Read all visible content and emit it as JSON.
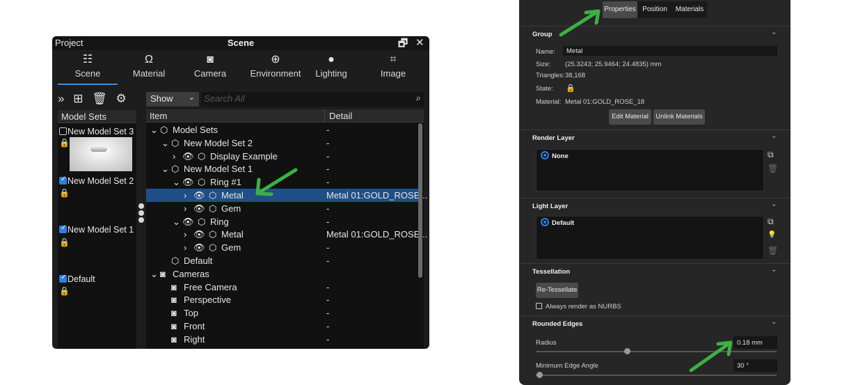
{
  "scene_window": {
    "title_left": "Project",
    "title_center": "Scene",
    "restore_glyph": "🗗",
    "close_glyph": "✕",
    "tabs": [
      {
        "label": "Scene",
        "icon": "☷"
      },
      {
        "label": "Material",
        "icon": "Ω"
      },
      {
        "label": "Camera",
        "icon": "◙"
      },
      {
        "label": "Environment",
        "icon": "⊕"
      },
      {
        "label": "Lighting",
        "icon": "●"
      },
      {
        "label": "Image",
        "icon": "⌗"
      }
    ],
    "toolbar": {
      "expand": "»",
      "add": "⊞",
      "delete": "🗑",
      "settings": "⚙"
    },
    "filter": {
      "value": "Show",
      "chevron": "⌄",
      "search_placeholder": "Search All",
      "search_icon": "⌕"
    },
    "model_sets": {
      "header": "Model Sets",
      "lock_glyph": "🔒",
      "items": [
        {
          "label": "New Model Set 3",
          "checked": false
        },
        {
          "label": "New Model Set 2",
          "checked": true
        },
        {
          "label": "New Model Set 1",
          "checked": true
        },
        {
          "label": "Default",
          "checked": true
        }
      ]
    },
    "tree": {
      "col_item": "Item",
      "col_detail": "Detail",
      "rows": [
        {
          "arrow": "⌄",
          "eye": "",
          "icon": "⬡",
          "label": "Model Sets",
          "detail": "-"
        },
        {
          "arrow": "⌄",
          "eye": "",
          "icon": "⬡",
          "label": "New Model Set 2",
          "detail": "-"
        },
        {
          "arrow": "›",
          "eye": "👁",
          "icon": "⬡",
          "label": "Display Example",
          "detail": "-"
        },
        {
          "arrow": "⌄",
          "eye": "",
          "icon": "⬡",
          "label": "New Model Set 1",
          "detail": "-"
        },
        {
          "arrow": "⌄",
          "eye": "👁",
          "icon": "⬡",
          "label": "Ring #1",
          "detail": "-"
        },
        {
          "arrow": "›",
          "eye": "👁",
          "icon": "⬡",
          "label": "Metal",
          "detail": "Metal 01:GOLD_ROSE..."
        },
        {
          "arrow": "›",
          "eye": "👁",
          "icon": "⬡",
          "label": "Gem",
          "detail": "-"
        },
        {
          "arrow": "⌄",
          "eye": "👁",
          "icon": "⬡",
          "label": "Ring",
          "detail": "-"
        },
        {
          "arrow": "›",
          "eye": "👁",
          "icon": "⬡",
          "label": "Metal",
          "detail": "Metal 01:GOLD_ROSE..."
        },
        {
          "arrow": "›",
          "eye": "👁",
          "icon": "⬡",
          "label": "Gem",
          "detail": "-"
        },
        {
          "arrow": "",
          "eye": "",
          "icon": "⬡",
          "label": "Default",
          "detail": "-"
        },
        {
          "arrow": "⌄",
          "eye": "",
          "icon": "◙",
          "label": "Cameras",
          "detail": ""
        },
        {
          "arrow": "",
          "eye": "",
          "icon": "◙",
          "label": "Free Camera",
          "detail": "-"
        },
        {
          "arrow": "",
          "eye": "",
          "icon": "◙",
          "label": "Perspective",
          "detail": "-"
        },
        {
          "arrow": "",
          "eye": "",
          "icon": "◙",
          "label": "Top",
          "detail": "-"
        },
        {
          "arrow": "",
          "eye": "",
          "icon": "◙",
          "label": "Front",
          "detail": "-"
        },
        {
          "arrow": "",
          "eye": "",
          "icon": "◙",
          "label": "Right",
          "detail": "-"
        }
      ]
    }
  },
  "properties_panel": {
    "tabs": [
      "Properties",
      "Position",
      "Materials"
    ],
    "active_tab": "Properties",
    "chevron": "⌄",
    "group": {
      "header": "Group",
      "name_label": "Name:",
      "name_value": "Metal",
      "size_label": "Size:",
      "size_value": "(25.3243; 25.9464; 24.4835) mm",
      "triangles_label": "Triangles:",
      "triangles_value": "38,168",
      "state_label": "State:",
      "state_icon": "🔒",
      "material_label": "Material:",
      "material_value": "Metal 01:GOLD_ROSE_18",
      "edit_material": "Edit Material",
      "unlink_materials": "Unlink Materials"
    },
    "render_layer": {
      "header": "Render Layer",
      "item": "None",
      "add_icon": "⧉",
      "delete_icon": "🗑"
    },
    "light_layer": {
      "header": "Light Layer",
      "item": "Default",
      "add_icon": "⧉",
      "light_icon": "💡",
      "delete_icon": "🗑"
    },
    "tessellation": {
      "header": "Tessellation",
      "retessellate": "Re-Tessellate",
      "nurbs_label": "Always render as NURBS",
      "nurbs_checked": false
    },
    "rounded_edges": {
      "header": "Rounded Edges",
      "radius_label": "Radius",
      "radius_value": "0.18 mm",
      "min_angle_label": "Minimum Edge Angle",
      "min_angle_value": "30 °"
    }
  },
  "annotation_color": "#3cb043"
}
